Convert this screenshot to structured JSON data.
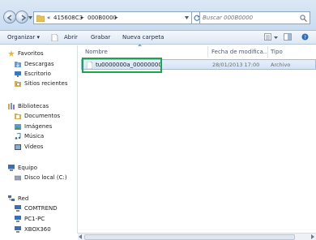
{
  "address_bar": {
    "crumbs": [
      "«",
      "415608C3",
      "►",
      "000B0000",
      "►"
    ],
    "search_placeholder": "Buscar 000B0000"
  },
  "toolbar": {
    "organize": "Organizar ▾",
    "open": "Abrir",
    "burn": "Grabar",
    "new_folder": "Nueva carpeta"
  },
  "nav": {
    "favorites": "Favoritos",
    "downloads": "Descargas",
    "desktop": "Escritorio",
    "recent": "Sitios recientes",
    "libraries": "Bibliotecas",
    "documents": "Documentos",
    "images": "Imágenes",
    "music": "Música",
    "videos": "Vídeos",
    "computer": "Equipo",
    "local_disk": "Disco local (C:)",
    "network": "Red",
    "net1": "COMTREND",
    "net2": "PC1-PC",
    "net3": "XBOX360"
  },
  "columns": {
    "name": "Nombre",
    "date": "Fecha de modifica...",
    "type": "Tipo"
  },
  "files": [
    {
      "name": "tu0000000a_00000000",
      "date": "28/01/2013 17:00",
      "type": "Archivo"
    }
  ],
  "colors": {
    "highlight": "#1aa64c",
    "selection": "#d3e5f8"
  }
}
